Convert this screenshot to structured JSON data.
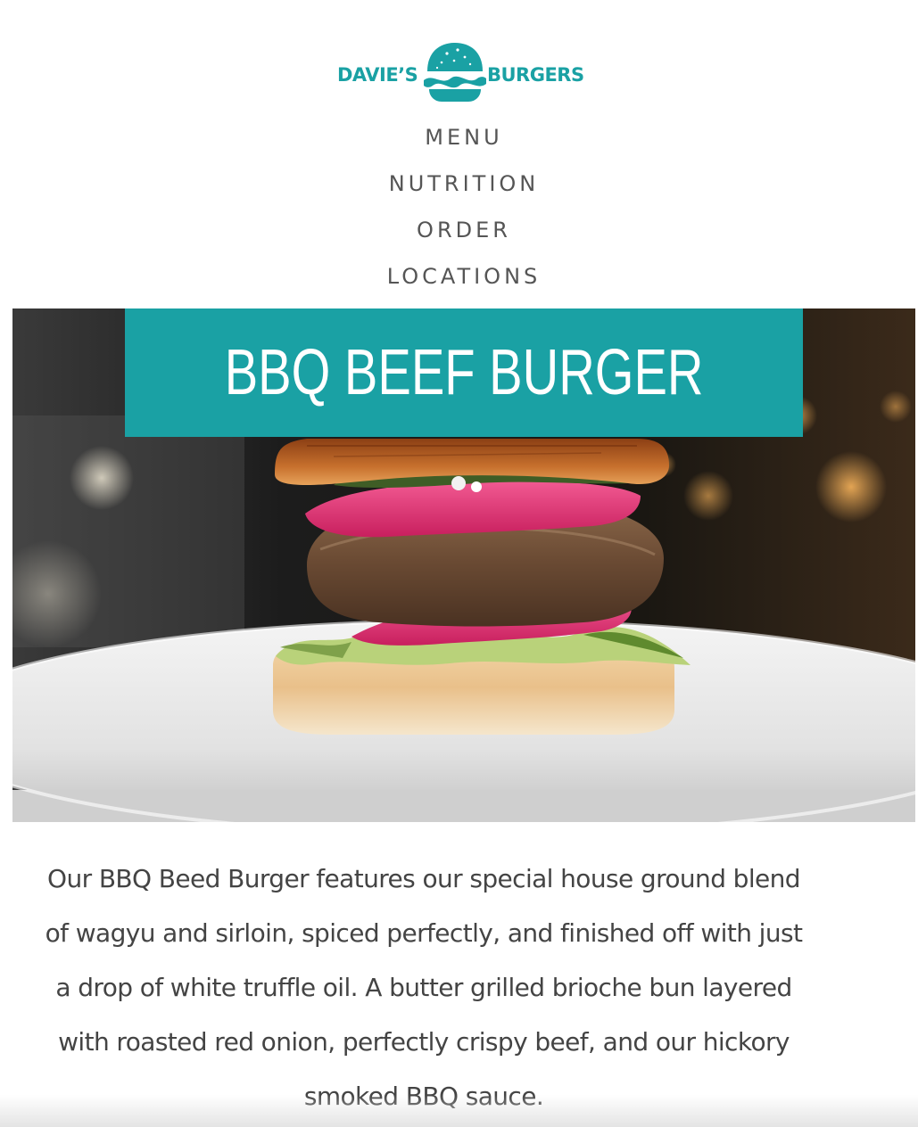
{
  "colors": {
    "brand": "#1aa1a4",
    "nav_text": "#555555",
    "body_text": "#444444"
  },
  "header": {
    "logo": {
      "left_word": "DAVIE’S",
      "right_word": "BURGERS",
      "emblem_icon": "burger-icon"
    }
  },
  "nav": {
    "items": [
      {
        "label": "MENU"
      },
      {
        "label": "NUTRITION"
      },
      {
        "label": "ORDER"
      },
      {
        "label": "LOCATIONS"
      }
    ]
  },
  "hero": {
    "title": "BBQ BEEF BURGER",
    "image": "burger-photo"
  },
  "description": {
    "text": "Our BBQ Beed Burger features our special house ground blend of wagyu and sirloin, spiced perfectly, and finished off with just a drop of white truffle oil. A butter grilled brioche bun layered with roasted red onion, perfectly crispy beef, and our hickory smoked BBQ sauce."
  }
}
